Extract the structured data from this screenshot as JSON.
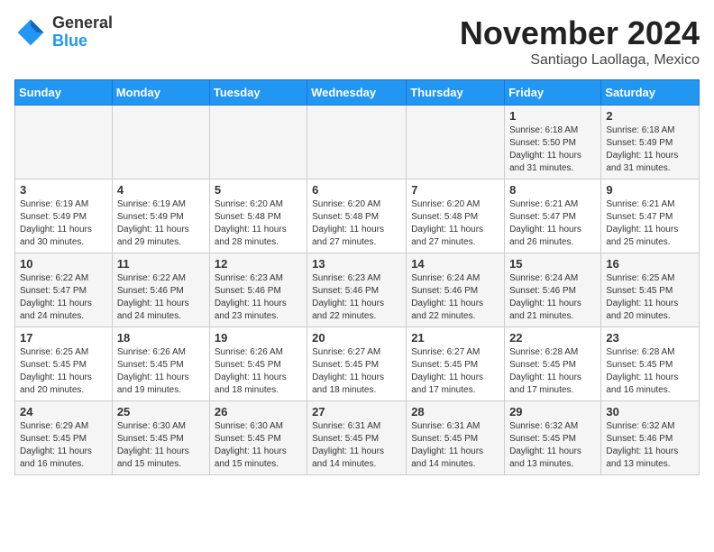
{
  "logo": {
    "line1": "General",
    "line2": "Blue"
  },
  "title": "November 2024",
  "location": "Santiago Laollaga, Mexico",
  "days_of_week": [
    "Sunday",
    "Monday",
    "Tuesday",
    "Wednesday",
    "Thursday",
    "Friday",
    "Saturday"
  ],
  "weeks": [
    [
      {
        "day": "",
        "info": ""
      },
      {
        "day": "",
        "info": ""
      },
      {
        "day": "",
        "info": ""
      },
      {
        "day": "",
        "info": ""
      },
      {
        "day": "",
        "info": ""
      },
      {
        "day": "1",
        "info": "Sunrise: 6:18 AM\nSunset: 5:50 PM\nDaylight: 11 hours and 31 minutes."
      },
      {
        "day": "2",
        "info": "Sunrise: 6:18 AM\nSunset: 5:49 PM\nDaylight: 11 hours and 31 minutes."
      }
    ],
    [
      {
        "day": "3",
        "info": "Sunrise: 6:19 AM\nSunset: 5:49 PM\nDaylight: 11 hours and 30 minutes."
      },
      {
        "day": "4",
        "info": "Sunrise: 6:19 AM\nSunset: 5:49 PM\nDaylight: 11 hours and 29 minutes."
      },
      {
        "day": "5",
        "info": "Sunrise: 6:20 AM\nSunset: 5:48 PM\nDaylight: 11 hours and 28 minutes."
      },
      {
        "day": "6",
        "info": "Sunrise: 6:20 AM\nSunset: 5:48 PM\nDaylight: 11 hours and 27 minutes."
      },
      {
        "day": "7",
        "info": "Sunrise: 6:20 AM\nSunset: 5:48 PM\nDaylight: 11 hours and 27 minutes."
      },
      {
        "day": "8",
        "info": "Sunrise: 6:21 AM\nSunset: 5:47 PM\nDaylight: 11 hours and 26 minutes."
      },
      {
        "day": "9",
        "info": "Sunrise: 6:21 AM\nSunset: 5:47 PM\nDaylight: 11 hours and 25 minutes."
      }
    ],
    [
      {
        "day": "10",
        "info": "Sunrise: 6:22 AM\nSunset: 5:47 PM\nDaylight: 11 hours and 24 minutes."
      },
      {
        "day": "11",
        "info": "Sunrise: 6:22 AM\nSunset: 5:46 PM\nDaylight: 11 hours and 24 minutes."
      },
      {
        "day": "12",
        "info": "Sunrise: 6:23 AM\nSunset: 5:46 PM\nDaylight: 11 hours and 23 minutes."
      },
      {
        "day": "13",
        "info": "Sunrise: 6:23 AM\nSunset: 5:46 PM\nDaylight: 11 hours and 22 minutes."
      },
      {
        "day": "14",
        "info": "Sunrise: 6:24 AM\nSunset: 5:46 PM\nDaylight: 11 hours and 22 minutes."
      },
      {
        "day": "15",
        "info": "Sunrise: 6:24 AM\nSunset: 5:46 PM\nDaylight: 11 hours and 21 minutes."
      },
      {
        "day": "16",
        "info": "Sunrise: 6:25 AM\nSunset: 5:45 PM\nDaylight: 11 hours and 20 minutes."
      }
    ],
    [
      {
        "day": "17",
        "info": "Sunrise: 6:25 AM\nSunset: 5:45 PM\nDaylight: 11 hours and 20 minutes."
      },
      {
        "day": "18",
        "info": "Sunrise: 6:26 AM\nSunset: 5:45 PM\nDaylight: 11 hours and 19 minutes."
      },
      {
        "day": "19",
        "info": "Sunrise: 6:26 AM\nSunset: 5:45 PM\nDaylight: 11 hours and 18 minutes."
      },
      {
        "day": "20",
        "info": "Sunrise: 6:27 AM\nSunset: 5:45 PM\nDaylight: 11 hours and 18 minutes."
      },
      {
        "day": "21",
        "info": "Sunrise: 6:27 AM\nSunset: 5:45 PM\nDaylight: 11 hours and 17 minutes."
      },
      {
        "day": "22",
        "info": "Sunrise: 6:28 AM\nSunset: 5:45 PM\nDaylight: 11 hours and 17 minutes."
      },
      {
        "day": "23",
        "info": "Sunrise: 6:28 AM\nSunset: 5:45 PM\nDaylight: 11 hours and 16 minutes."
      }
    ],
    [
      {
        "day": "24",
        "info": "Sunrise: 6:29 AM\nSunset: 5:45 PM\nDaylight: 11 hours and 16 minutes."
      },
      {
        "day": "25",
        "info": "Sunrise: 6:30 AM\nSunset: 5:45 PM\nDaylight: 11 hours and 15 minutes."
      },
      {
        "day": "26",
        "info": "Sunrise: 6:30 AM\nSunset: 5:45 PM\nDaylight: 11 hours and 15 minutes."
      },
      {
        "day": "27",
        "info": "Sunrise: 6:31 AM\nSunset: 5:45 PM\nDaylight: 11 hours and 14 minutes."
      },
      {
        "day": "28",
        "info": "Sunrise: 6:31 AM\nSunset: 5:45 PM\nDaylight: 11 hours and 14 minutes."
      },
      {
        "day": "29",
        "info": "Sunrise: 6:32 AM\nSunset: 5:45 PM\nDaylight: 11 hours and 13 minutes."
      },
      {
        "day": "30",
        "info": "Sunrise: 6:32 AM\nSunset: 5:46 PM\nDaylight: 11 hours and 13 minutes."
      }
    ]
  ]
}
